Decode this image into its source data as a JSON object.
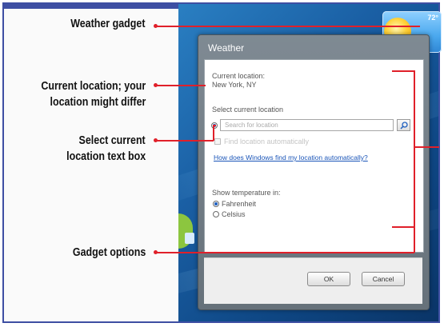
{
  "callouts": {
    "weather_gadget": "Weather gadget",
    "current_location_l1": "Current location; your",
    "current_location_l2": "location might differ",
    "select_location_l1": "Select current",
    "select_location_l2": "location text box",
    "gadget_options": "Gadget options"
  },
  "gadget": {
    "temp": "72°",
    "icon": "sun-cloud-icon"
  },
  "dialog": {
    "title": "Weather",
    "current_location_label": "Current location:",
    "current_location_value": "New York, NY",
    "select_label": "Select current location",
    "search_placeholder": "Search for location",
    "search_icon": "magnifier-icon",
    "find_auto_label": "Find location automatically",
    "help_link": "How does Windows find my location automatically?",
    "temp_label": "Show temperature in:",
    "option_fahrenheit": "Fahrenheit",
    "option_celsius": "Celsius",
    "ok": "OK",
    "cancel": "Cancel"
  },
  "colors": {
    "frame": "#3e4fa3",
    "callout": "#e0202a",
    "dialog": "#6e7880",
    "link": "#1a55b8"
  }
}
